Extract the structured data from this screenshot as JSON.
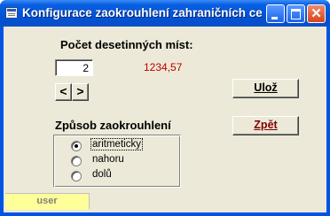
{
  "window": {
    "title": "Konfigurace zaokrouhlení zahraničních cen",
    "buttons": [
      "minimize",
      "maximize",
      "close"
    ]
  },
  "decimals": {
    "label": "Počet desetinných míst:",
    "value": "2",
    "preview": "1234,57",
    "decrease_label": "<",
    "increase_label": ">"
  },
  "actions": {
    "save_label": "Ulož",
    "back_label": "Zpět"
  },
  "rounding": {
    "label": "Způsob zaokrouhlení",
    "options": [
      {
        "label": "aritmeticky",
        "checked": true
      },
      {
        "label": "nahoru",
        "checked": false
      },
      {
        "label": "dolů",
        "checked": false
      }
    ]
  },
  "status": {
    "user": "user"
  },
  "colors": {
    "titlebar": "#0054e3",
    "client": "#ece9d8",
    "preview_text": "#c00000",
    "status_bg": "#ffff99"
  }
}
